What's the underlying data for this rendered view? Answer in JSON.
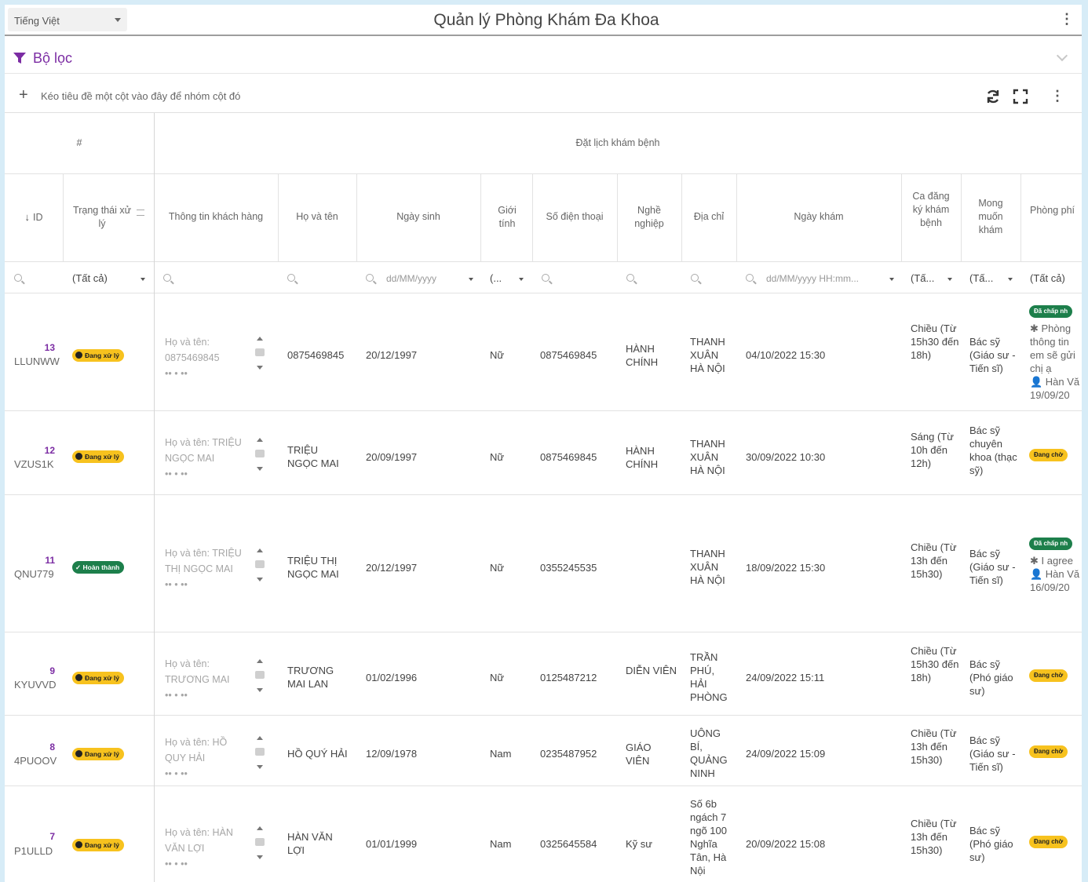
{
  "header": {
    "language": "Tiếng Việt",
    "title": "Quản lý Phòng Khám Đa Khoa"
  },
  "filter": {
    "label": "Bộ lọc"
  },
  "groupbar": {
    "hint": "Kéo tiêu đề một cột vào đây để nhóm cột đó"
  },
  "grid": {
    "band_index": "#",
    "band_main": "Đặt lịch khám bệnh",
    "columns": {
      "id": "ID",
      "status": "Trạng thái xử lý",
      "customer": "Thông tin khách hàng",
      "name": "Họ và tên",
      "dob": "Ngày sinh",
      "gender": "Giới tính",
      "phone": "Số điện thoại",
      "job": "Nghề nghiệp",
      "address": "Địa chỉ",
      "visit_date": "Ngày khám",
      "shift": "Ca đăng ký khám bệnh",
      "wish": "Mong muốn khám",
      "fee": "Phòng phí"
    },
    "filters": {
      "status": "(Tất cả)",
      "dob_placeholder": "dd/MM/yyyy",
      "gender": "(...",
      "date_placeholder": "dd/MM/yyyy HH:mm...",
      "shift": "(Tấ...",
      "wish": "(Tấ...",
      "fee": "(Tất cả)"
    },
    "rows": [
      {
        "num": "13",
        "code": "LLUNWW",
        "status": "Đang xử lý",
        "status_type": "proc",
        "customer": [
          "Họ và tên:",
          "0875469845",
          "•• •  ••"
        ],
        "name": "0875469845",
        "dob": "20/12/1997",
        "gender": "Nữ",
        "phone": "0875469845",
        "job": "HÀNH CHÍNH",
        "address": "THANH XUÂN HÀ NỘI",
        "visit": "04/10/2022 15:30",
        "shift": "Chiều (Từ 15h30 đến 18h)",
        "wish": "Bác sỹ (Giáo sư - Tiến sĩ)",
        "fee_badge": "Đã chấp nh",
        "fee_type": "done",
        "fee_lines": [
          "✱ Phòng",
          "thông tin",
          "em sẽ gửi",
          "chị ạ",
          "👤 Hàn Vă",
          "19/09/20"
        ]
      },
      {
        "num": "12",
        "code": "VZUS1K",
        "status": "Đang xử lý",
        "status_type": "proc",
        "customer": [
          "Họ và tên: TRIỆU",
          "NGỌC MAI",
          "•• •  ••"
        ],
        "name": "TRIỆU NGỌC MAI",
        "dob": "20/09/1997",
        "gender": "Nữ",
        "phone": "0875469845",
        "job": "HÀNH CHÍNH",
        "address": "THANH XUÂN HÀ NỘI",
        "visit": "30/09/2022 10:30",
        "shift": "Sáng (Từ 10h đến 12h)",
        "wish": "Bác sỹ chuyên khoa (thạc sỹ)",
        "fee_badge": "Đang chờ",
        "fee_type": "proc",
        "fee_lines": []
      },
      {
        "num": "11",
        "code": "QNU779",
        "status": "Hoàn thành",
        "status_type": "done",
        "customer": [
          "Họ và tên: TRIỆU",
          "THỊ NGỌC MAI",
          "•• •  ••"
        ],
        "name": "TRIỆU THỊ NGỌC MAI",
        "dob": "20/12/1997",
        "gender": "Nữ",
        "phone": "0355245535",
        "job": "",
        "address": "THANH XUÂN HÀ NỘI",
        "visit": "18/09/2022 15:30",
        "shift": "Chiều (Từ 13h đến 15h30)",
        "wish": "Bác sỹ (Giáo sư - Tiến sĩ)",
        "fee_badge": "Đã chấp nh",
        "fee_type": "done",
        "fee_lines": [
          "✱ I agree",
          "👤 Hàn Vă",
          "16/09/20"
        ]
      },
      {
        "num": "9",
        "code": "KYUVVD",
        "status": "Đang xử lý",
        "status_type": "proc",
        "customer": [
          "Họ và tên:",
          "TRƯƠNG MAI",
          "•• •  ••"
        ],
        "name": "TRƯƠNG MAI LAN",
        "dob": "01/02/1996",
        "gender": "Nữ",
        "phone": "0125487212",
        "job": "DIỄN VIÊN",
        "address": "TRẦN PHÚ, HẢI PHÒNG",
        "visit": "24/09/2022 15:11",
        "shift": "Chiều (Từ 15h30 đến 18h)",
        "wish": "Bác sỹ (Phó giáo sư)",
        "fee_badge": "Đang chờ",
        "fee_type": "proc",
        "fee_lines": []
      },
      {
        "num": "8",
        "code": "4PUOOV",
        "status": "Đang xử lý",
        "status_type": "proc",
        "customer": [
          "Họ và tên: HỒ",
          "QUY HẢI",
          "•• •  ••"
        ],
        "name": "HỒ QUÝ HẢI",
        "dob": "12/09/1978",
        "gender": "Nam",
        "phone": "0235487952",
        "job": "GIÁO VIÊN",
        "address": "UÔNG BÍ, QUẢNG NINH",
        "visit": "24/09/2022 15:09",
        "shift": "Chiều (Từ 13h đến 15h30)",
        "wish": "Bác sỹ (Giáo sư - Tiến sĩ)",
        "fee_badge": "Đang chờ",
        "fee_type": "proc",
        "fee_lines": []
      },
      {
        "num": "7",
        "code": "P1ULLD",
        "status": "Đang xử lý",
        "status_type": "proc",
        "customer": [
          "Họ và tên: HÀN",
          "VĂN LỢI",
          "•• •  ••"
        ],
        "name": "HÀN VĂN LỢI",
        "dob": "01/01/1999",
        "gender": "Nam",
        "phone": "0325645584",
        "job": "Kỹ sư",
        "address": "Số 6b ngách 7 ngõ 100 Nghĩa Tân, Hà Nội",
        "visit": "20/09/2022 15:08",
        "shift": "Chiều (Từ 13h đến 15h30)",
        "wish": "Bác sỹ (Phó giáo sư)",
        "fee_badge": "Đang chờ",
        "fee_type": "proc",
        "fee_lines": []
      }
    ]
  }
}
